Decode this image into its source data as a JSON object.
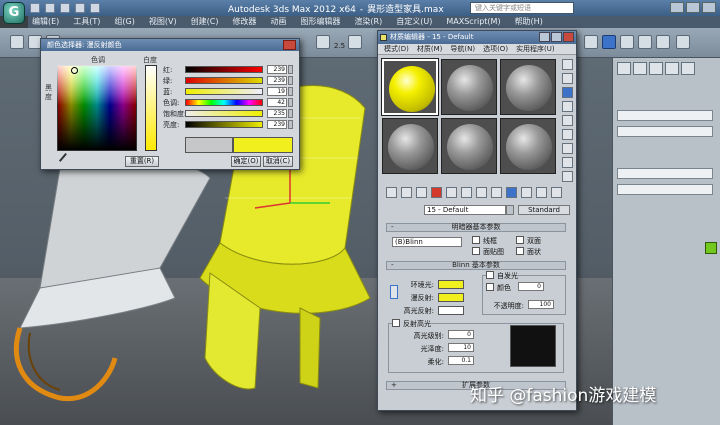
{
  "app": {
    "logo_glyph": "G",
    "title": "Autodesk 3ds Max  2012 x64",
    "file_name": "異形造型家具.max",
    "search_placeholder": "键入关键字或短语",
    "menus": [
      "编辑(E)",
      "工具(T)",
      "组(G)",
      "视图(V)",
      "创建(C)",
      "修改器",
      "动画",
      "图形编辑器",
      "渲染(R)",
      "自定义(U)",
      "MAXScript(M)",
      "帮助(H)"
    ],
    "toolbar_value": "2.5"
  },
  "color_dialog": {
    "title": "颜色选择器: 漫反射颜色",
    "hue_label": "色调",
    "whiteness_label": "白度",
    "blackness_label": "黑度",
    "sliders": [
      {
        "label": "红:",
        "value": "239",
        "colors": [
          "#000000",
          "#ff0000"
        ]
      },
      {
        "label": "绿:",
        "value": "239",
        "colors": [
          "#dd0000",
          "#dddd00"
        ]
      },
      {
        "label": "蓝:",
        "value": "19",
        "colors": [
          "#eeee00",
          "#eeeeff"
        ]
      },
      {
        "label": "色调:",
        "value": "42",
        "colors": [
          "#ff0000",
          "#ffff00",
          "#00ff00",
          "#00ffff",
          "#0000ff",
          "#ff00ff",
          "#ff0000"
        ]
      },
      {
        "label": "饱和度:",
        "value": "235",
        "colors": [
          "#eeeeee",
          "#eeee00"
        ]
      },
      {
        "label": "亮度:",
        "value": "239",
        "colors": [
          "#000000",
          "#eeee00"
        ]
      }
    ],
    "reset_label": "重置(R)",
    "ok_label": "确定(O)",
    "cancel_label": "取消(C)",
    "old_color": "#c5c7c9",
    "new_color": "#f2ef1e"
  },
  "material_editor": {
    "title": "材质编辑器 - 15 - Default",
    "menus": [
      "模式(D)",
      "材质(M)",
      "导航(N)",
      "选项(O)",
      "实用程序(U)"
    ],
    "slots": [
      {
        "color": "yellow",
        "selected": true
      },
      {
        "color": "gray",
        "selected": false
      },
      {
        "color": "gray",
        "selected": false
      },
      {
        "color": "gray",
        "selected": false
      },
      {
        "color": "gray",
        "selected": false
      },
      {
        "color": "gray",
        "selected": false
      }
    ],
    "material_name": "15 - Default",
    "material_type": "Standard",
    "shader_rollout": "明暗器基本参数",
    "shader_type": "(B)Blinn",
    "shader_options": [
      "线框",
      "双面",
      "面贴图",
      "面状"
    ],
    "blinn_rollout": "Blinn 基本参数",
    "self_illum_label": "自发光",
    "self_illum_color_label": "颜色",
    "self_illum_value": "0",
    "opacity_label": "不透明度:",
    "opacity_value": "100",
    "ambient_label": "环境光:",
    "diffuse_label": "漫反射:",
    "specular_label": "高光反射:",
    "ambient_color": "#f2ef1e",
    "diffuse_color": "#f2ef1e",
    "specular_color": "#ffffff",
    "specular_group_label": "反射高光",
    "spec_level_label": "高光级别:",
    "spec_level_value": "0",
    "glossiness_label": "光泽度:",
    "glossiness_value": "10",
    "soften_label": "柔化:",
    "soften_value": "0.1",
    "extended_rollout": "扩展参数"
  },
  "watermark": "知乎 @fashion游戏建模"
}
